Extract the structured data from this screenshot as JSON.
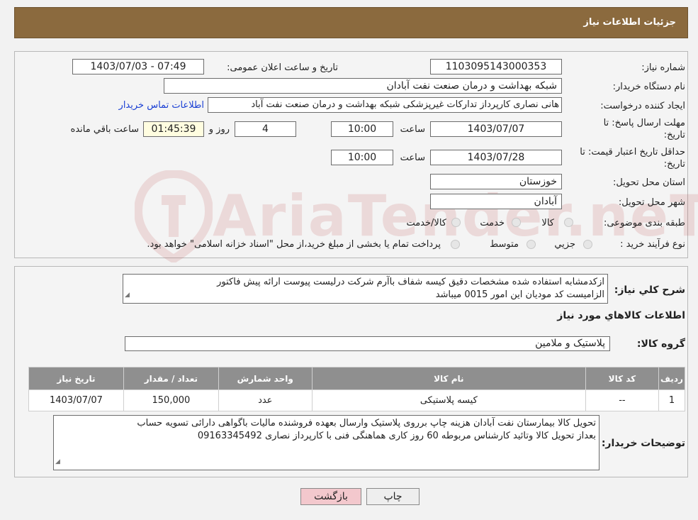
{
  "header": {
    "title": "جزئیات اطلاعات نیاز"
  },
  "watermark": {
    "text": "AriaTender.neT"
  },
  "form": {
    "need_number_label": "شماره نیاز:",
    "need_number": "1103095143000353",
    "announce_label": "تاریخ و ساعت اعلان عمومی:",
    "announce_value": "1403/07/03 - 07:49",
    "buyer_org_label": "نام دستگاه خریدار:",
    "buyer_org": "شبکه بهداشت و درمان صنعت نفت آبادان",
    "creator_label": "ایجاد کننده درخواست:",
    "creator": "هانی نصاری کارپرداز تدارکات غیرپزشکی شبکه بهداشت و درمان صنعت نفت آباد",
    "contact_link": "اطلاعات تماس خریدار",
    "reply_deadline_label": "مهلت ارسال پاسخ: تا",
    "reply_deadline_label2": "تاریخ:",
    "reply_date": "1403/07/07",
    "time_label": "ساعت",
    "reply_time": "10:00",
    "days": "4",
    "days_label": "روز و",
    "remaining": "01:45:39",
    "remaining_label": "ساعت باقي مانده",
    "validity_label": "حداقل تاریخ اعتبار قیمت: تا",
    "validity_label2": "تاریخ:",
    "validity_date": "1403/07/28",
    "validity_time": "10:00",
    "province_label": "استان محل تحویل:",
    "province": "خوزستان",
    "city_label": "شهر محل تحویل:",
    "city": "آبادان",
    "category_label": "طبقه بندی موضوعی:",
    "cat_goods": "کالا",
    "cat_service": "خدمت",
    "cat_both": "کالا/خدمت",
    "process_label": "نوع فرآیند خرید :",
    "proc_partial": "جزيي",
    "proc_medium": "متوسط",
    "proc_note": "پرداخت تمام یا بخشی از مبلغ خرید،از محل \"اسناد خزانه اسلامی\" خواهد بود."
  },
  "details": {
    "summary_label": "شرح کلي نياز:",
    "summary_line1": "ازکدمشابه استفاده شده مشخصات دقیق  کیسه شفاف باآرم شرکت درلیست پیوست ارائه پیش فاکتور",
    "summary_line2": "الزامیست  کد مودیان این امور 0015 میباشد",
    "goods_info_title": "اطلاعات کالاهاي مورد نياز",
    "group_label": "گروه کالا:",
    "group_value": "پلاستیک و ملامین"
  },
  "table": {
    "headers": [
      "رديف",
      "کد کالا",
      "نام کالا",
      "واحد شمارش",
      "تعداد / مقدار",
      "تاریخ نیاز"
    ],
    "rows": [
      [
        "1",
        "--",
        "کیسه پلاستیکی",
        "عدد",
        "150,000",
        "1403/07/07"
      ]
    ]
  },
  "buyer_notes": {
    "label": "توضیحات خریدار:",
    "line1": "تحویل کالا بیمارستان نفت آبادان هزینه چاپ برروی پلاستیک وارسال بعهده فروشنده مالیات باگواهی دارائی تسویه حساب",
    "line2": "بعداز تحویل کالا وتائید کارشناس مربوطه 60 روز کاری هماهنگی فنی با کارپرداز نصاری 09163345492"
  },
  "buttons": {
    "print": "چاپ",
    "back": "بازگشت"
  }
}
